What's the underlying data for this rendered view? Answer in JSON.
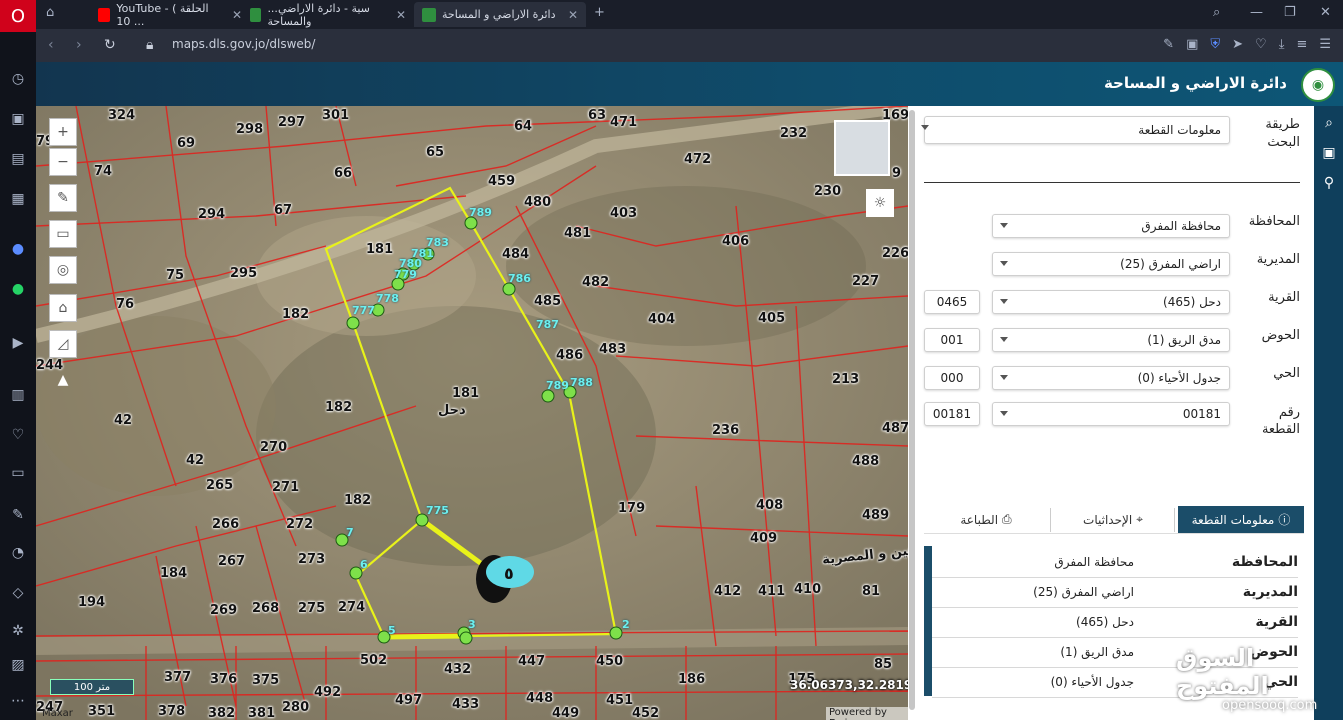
{
  "browser": {
    "tabs": [
      {
        "label": "YouTube - ( الحلقة 10 ..."
      },
      {
        "label": "...سية - دائرة الاراضي والمساحة"
      },
      {
        "label": "دائرة الاراضي و المساحة"
      }
    ],
    "url": "maps.dls.gov.jo/dlsweb/"
  },
  "site": {
    "title": "دائرة الاراضي و المساحة"
  },
  "map": {
    "parcel_labels": [
      {
        "t": "324"
      },
      {
        "t": "79"
      },
      {
        "t": "298"
      },
      {
        "t": "297"
      },
      {
        "t": "301"
      },
      {
        "t": "63"
      },
      {
        "t": "471"
      },
      {
        "t": "64"
      },
      {
        "t": "232"
      },
      {
        "t": "169"
      },
      {
        "t": "69"
      },
      {
        "t": "65"
      },
      {
        "t": "472"
      },
      {
        "t": "74"
      },
      {
        "t": "66"
      },
      {
        "t": "459"
      },
      {
        "t": "230"
      },
      {
        "t": "9"
      },
      {
        "t": "480"
      },
      {
        "t": "403"
      },
      {
        "t": "294"
      },
      {
        "t": "67"
      },
      {
        "t": "481"
      },
      {
        "t": "406"
      },
      {
        "t": "181"
      },
      {
        "t": "226"
      },
      {
        "t": "75"
      },
      {
        "t": "295"
      },
      {
        "t": "484"
      },
      {
        "t": "482"
      },
      {
        "t": "227"
      },
      {
        "t": "76"
      },
      {
        "t": "485"
      },
      {
        "t": "182"
      },
      {
        "t": "404"
      },
      {
        "t": "405"
      },
      {
        "t": "486"
      },
      {
        "t": "483"
      },
      {
        "t": "244"
      },
      {
        "t": "213"
      },
      {
        "t": "181"
      },
      {
        "t": "182"
      },
      {
        "t": "42"
      },
      {
        "t": "236"
      },
      {
        "t": "487"
      },
      {
        "t": "270"
      },
      {
        "t": "42"
      },
      {
        "t": "488"
      },
      {
        "t": "265"
      },
      {
        "t": "271"
      },
      {
        "t": "182"
      },
      {
        "t": "179"
      },
      {
        "t": "408"
      },
      {
        "t": "489"
      },
      {
        "t": "266"
      },
      {
        "t": "272"
      },
      {
        "t": "409"
      },
      {
        "t": "267"
      },
      {
        "t": "273"
      },
      {
        "t": "184"
      },
      {
        "t": "194"
      },
      {
        "t": "412"
      },
      {
        "t": "411"
      },
      {
        "t": "410"
      },
      {
        "t": "81"
      },
      {
        "t": "269"
      },
      {
        "t": "268"
      },
      {
        "t": "275"
      },
      {
        "t": "274"
      },
      {
        "t": "502"
      },
      {
        "t": "432"
      },
      {
        "t": "447"
      },
      {
        "t": "450"
      },
      {
        "t": "85"
      },
      {
        "t": "377"
      },
      {
        "t": "376"
      },
      {
        "t": "375"
      },
      {
        "t": "492"
      },
      {
        "t": "497"
      },
      {
        "t": "433"
      },
      {
        "t": "448"
      },
      {
        "t": "186"
      },
      {
        "t": "451"
      },
      {
        "t": "247"
      },
      {
        "t": "351"
      },
      {
        "t": "378"
      },
      {
        "t": "382"
      },
      {
        "t": "381"
      },
      {
        "t": "280"
      },
      {
        "t": "449"
      },
      {
        "t": "452"
      },
      {
        "t": "175"
      }
    ],
    "area_labels": [
      {
        "t": "دحل"
      },
      {
        "t": "عين و المصرية"
      }
    ],
    "vertex_labels": [
      {
        "t": "789"
      },
      {
        "t": "783"
      },
      {
        "t": "781"
      },
      {
        "t": "780"
      },
      {
        "t": "779"
      },
      {
        "t": "778"
      },
      {
        "t": "777"
      },
      {
        "t": "786"
      },
      {
        "t": "787"
      },
      {
        "t": "788"
      },
      {
        "t": "789"
      },
      {
        "t": "775"
      },
      {
        "t": "7"
      },
      {
        "t": "6"
      },
      {
        "t": "5"
      },
      {
        "t": "3"
      },
      {
        "t": "2"
      }
    ],
    "scale_text": "100 متر",
    "coordinates": "36.06373,32.28193",
    "attribution_left": "Maxar",
    "attribution_right": "Powered by Esri"
  },
  "panel": {
    "search_method_label": "طريقة البحث",
    "search_method_value": "معلومات القطعة",
    "fields": [
      {
        "label": "المحافظة",
        "value": "محافظة المفرق",
        "code": ""
      },
      {
        "label": "المديرية",
        "value": "اراضي المفرق (25)",
        "code": ""
      },
      {
        "label": "القرية",
        "value": "دحل (465)",
        "code": "0465"
      },
      {
        "label": "الحوض",
        "value": "مدق الريق (1)",
        "code": "001"
      },
      {
        "label": "الحي",
        "value": "جدول الأحياء (0)",
        "code": "000"
      },
      {
        "label": "رقم القطعة",
        "value": "00181",
        "code": "00181"
      }
    ],
    "tabs": [
      {
        "label": "معلومات القطعة"
      },
      {
        "label": "الإحداثيات"
      },
      {
        "label": "الطباعة"
      }
    ],
    "info_rows": [
      {
        "key": "المحافظة",
        "value": "محافظة المفرق"
      },
      {
        "key": "المديرية",
        "value": "اراضي المفرق (25)"
      },
      {
        "key": "القرية",
        "value": "دحل (465)"
      },
      {
        "key": "الحوض",
        "value": "مدق الريق (1)"
      },
      {
        "key": "الحي",
        "value": "جدول الأحياء (0)"
      }
    ]
  },
  "watermark": {
    "arabic": "السوق المفتوح",
    "latin": "opensooq.com"
  },
  "colors": {
    "parcel_line": "#e0231e",
    "selected_parcel": "#e8f21a",
    "vertex": "#7ee04a",
    "header": "#0f4c6b",
    "tab_active": "#1b4d69"
  }
}
